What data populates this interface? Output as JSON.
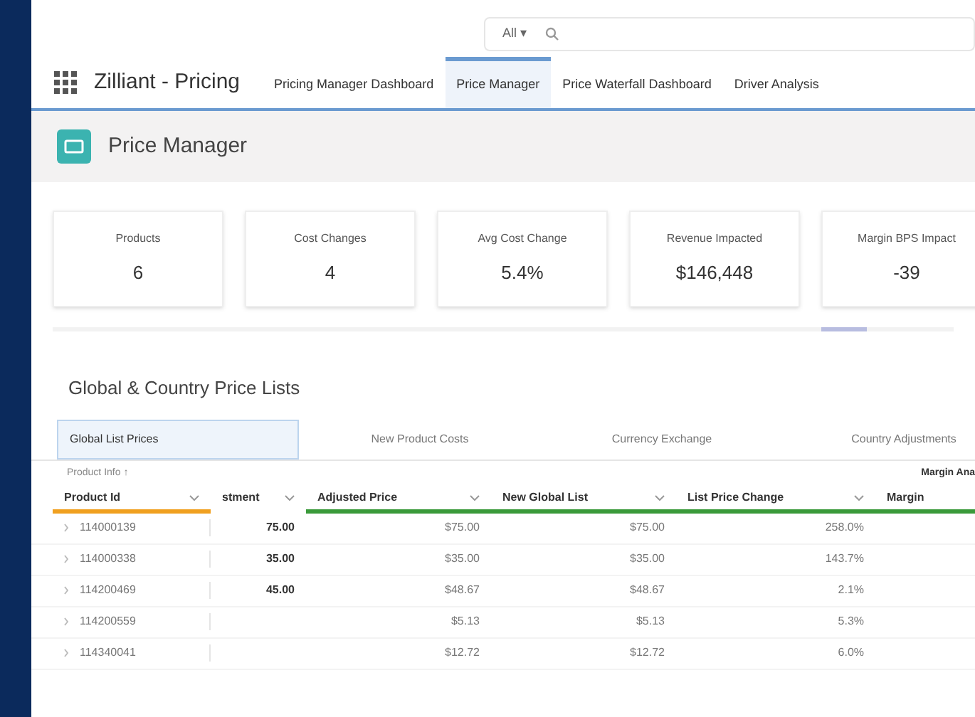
{
  "search": {
    "scope": "All",
    "scope_caret": "▾"
  },
  "app": {
    "name": "Zilliant - Pricing"
  },
  "nav": [
    {
      "label": "Pricing Manager Dashboard",
      "selected": false
    },
    {
      "label": "Price Manager",
      "selected": true
    },
    {
      "label": "Price Waterfall Dashboard",
      "selected": false
    },
    {
      "label": "Driver Analysis",
      "selected": false
    }
  ],
  "page_header": {
    "title": "Price Manager"
  },
  "stats": [
    {
      "label": "Products",
      "value": "6"
    },
    {
      "label": "Cost Changes",
      "value": "4"
    },
    {
      "label": "Avg Cost Change",
      "value": "5.4%"
    },
    {
      "label": "Revenue Impacted",
      "value": "$146,448"
    },
    {
      "label": "Margin BPS Impact",
      "value": "-39"
    }
  ],
  "section": {
    "title": "Global & Country Price Lists"
  },
  "tabs": [
    {
      "label": "Global List Prices",
      "selected": true
    },
    {
      "label": "New Product Costs",
      "selected": false
    },
    {
      "label": "Currency Exchange",
      "selected": false
    },
    {
      "label": "Country Adjustments",
      "selected": false
    }
  ],
  "table": {
    "groups": [
      {
        "label": "Product Info",
        "icon": "↑"
      },
      {
        "label": "Margin Ana"
      }
    ],
    "columns": [
      {
        "label": "Product Id",
        "color": "#f0a020"
      },
      {
        "label": "stment",
        "color": "#ffffff"
      },
      {
        "label": "Adjusted Price",
        "color": "#3a9a3a"
      },
      {
        "label": "New Global List",
        "color": "#3a9a3a"
      },
      {
        "label": "List Price Change",
        "color": "#3a9a3a"
      },
      {
        "label": "Margin",
        "color": "#3a9a3a"
      }
    ],
    "rows": [
      [
        "114000139",
        "75.00",
        "$75.00",
        "$75.00",
        "258.0%"
      ],
      [
        "114000338",
        "35.00",
        "$35.00",
        "$35.00",
        "143.7%"
      ],
      [
        "114200469",
        "45.00",
        "$48.67",
        "$48.67",
        "2.1%"
      ],
      [
        "114200559",
        "",
        "$5.13",
        "$5.13",
        "5.3%"
      ],
      [
        "114340041",
        "",
        "$12.72",
        "$12.72",
        "6.0%"
      ]
    ]
  }
}
